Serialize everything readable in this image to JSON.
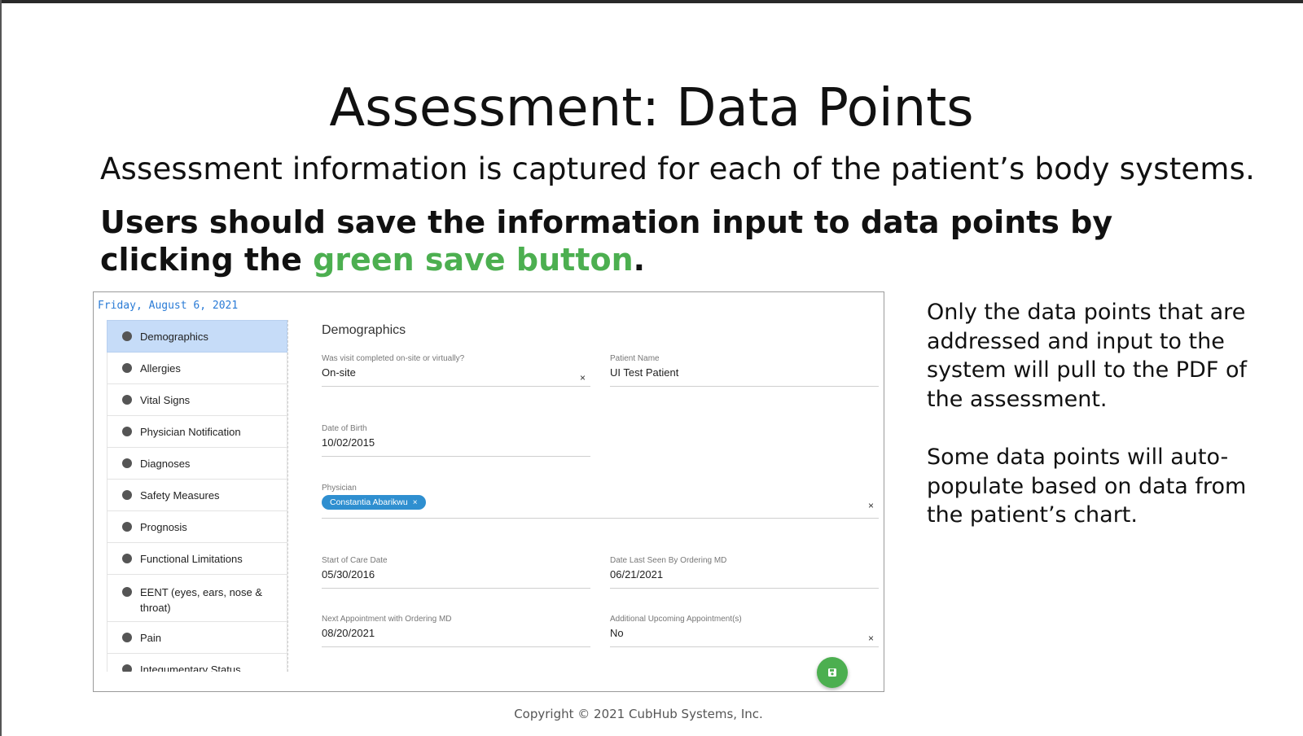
{
  "slide": {
    "title": "Assessment: Data Points",
    "subtitle": "Assessment information is captured for each of the patient’s body systems.",
    "instruction_text": "Users should save the information input to data points by clicking the",
    "instruction_green": "green save button",
    "instruction_end": ".",
    "notes": [
      "Only the data points that are addressed and input to the system will pull to the PDF of the assessment.",
      "Some data points will auto-populate based on data from the patient’s chart."
    ],
    "copyright": "Copyright © 2021 CubHub Systems, Inc.",
    "accent_color": "#4caf50"
  },
  "app": {
    "date": "Friday, August 6, 2021",
    "sidebar": {
      "items": [
        {
          "label": "Demographics",
          "active": true
        },
        {
          "label": "Allergies"
        },
        {
          "label": "Vital Signs"
        },
        {
          "label": "Physician Notification"
        },
        {
          "label": "Diagnoses"
        },
        {
          "label": "Safety Measures"
        },
        {
          "label": "Prognosis"
        },
        {
          "label": "Functional Limitations"
        },
        {
          "label": "EENT (eyes, ears, nose & throat)"
        },
        {
          "label": "Pain"
        },
        {
          "label": "Integumentary Status"
        }
      ]
    },
    "panel": {
      "title": "Demographics",
      "visit": {
        "label": "Was visit completed on-site or virtually?",
        "value": "On-site"
      },
      "patient_name": {
        "label": "Patient Name",
        "value": "UI Test Patient"
      },
      "dob": {
        "label": "Date of Birth",
        "value": "10/02/2015"
      },
      "physician": {
        "label": "Physician",
        "chip": "Constantia Abarikwu",
        "chip_remove": "×"
      },
      "start_of_care": {
        "label": "Start of Care Date",
        "value": "05/30/2016"
      },
      "date_last_seen": {
        "label": "Date Last Seen By Ordering MD",
        "value": "06/21/2021"
      },
      "next_appt": {
        "label": "Next Appointment with Ordering MD",
        "value": "08/20/2021"
      },
      "additional_appt": {
        "label": "Additional Upcoming Appointment(s)",
        "value": "No"
      },
      "clear_glyph": "×",
      "save_icon": "floppy-disk-icon"
    }
  }
}
